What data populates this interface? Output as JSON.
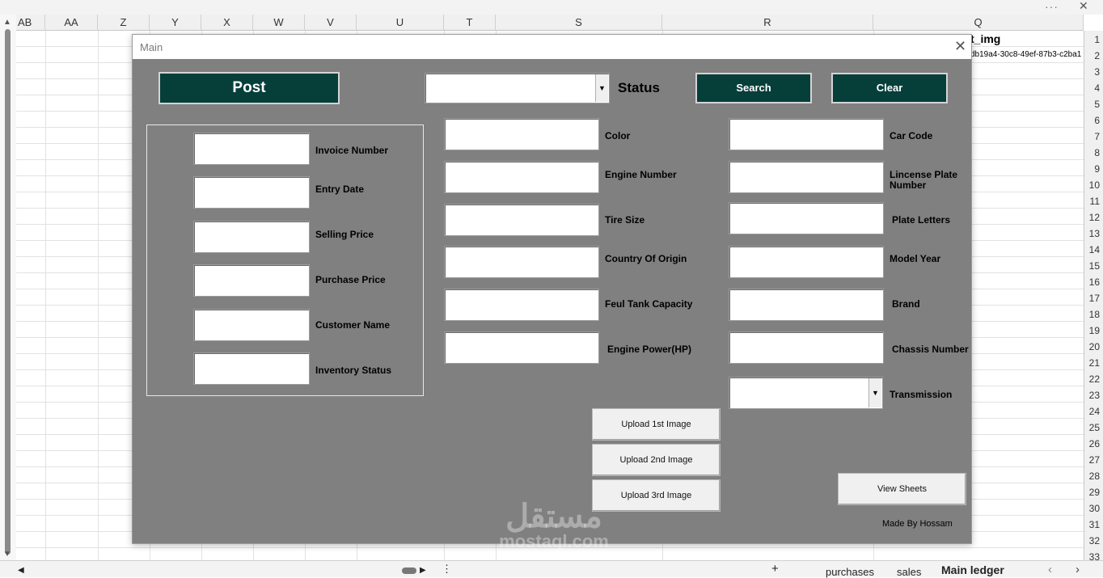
{
  "sheet": {
    "columns": [
      "AB",
      "AA",
      "Z",
      "Y",
      "X",
      "W",
      "V",
      "U",
      "T",
      "S",
      "R",
      "Q"
    ],
    "rows": [
      "1",
      "2",
      "3",
      "4",
      "5",
      "6",
      "7",
      "8",
      "9",
      "10",
      "11",
      "12",
      "13",
      "14",
      "15",
      "16",
      "17",
      "18",
      "19",
      "20",
      "21",
      "22",
      "23",
      "24",
      "25",
      "26",
      "27",
      "28",
      "29",
      "30",
      "31",
      "32",
      "33"
    ],
    "cell_q1": "t_img",
    "cell_q2": "db19a4-30c8-49ef-87b3-c2ba1",
    "tabs": [
      "purchases",
      "sales",
      "Main ledger"
    ],
    "active_tab": "Main ledger",
    "add_sheet": "+",
    "more": "⋮",
    "window_more": "···",
    "window_close": "✕"
  },
  "dialog": {
    "title": "Main",
    "close": "✕",
    "post_label": "Post",
    "status_label": "Status",
    "search_label": "Search",
    "clear_label": "Clear",
    "left_fields": [
      "Invoice Number",
      "Entry Date",
      "Selling Price",
      "Purchase Price",
      "Customer Name",
      "Inventory Status"
    ],
    "mid_fields": [
      "Color",
      "Engine Number",
      "Tire Size",
      "Country Of Origin",
      "Feul Tank Capacity",
      "Engine Power(HP)"
    ],
    "right_fields": [
      "Car Code",
      "Lincense Plate Number",
      "Plate Letters",
      "Model Year",
      "Brand",
      "Chassis Number",
      "Transmission"
    ],
    "upload_1": "Upload  1st Image",
    "upload_2": "Upload 2nd Image",
    "upload_3": "Upload 3rd Image",
    "view_sheets": "View Sheets",
    "made_by": "Made By Hossam",
    "dropdown_arrow": "▼"
  },
  "watermark": {
    "arabic": "مستقل",
    "latin": "mostaql.com"
  }
}
